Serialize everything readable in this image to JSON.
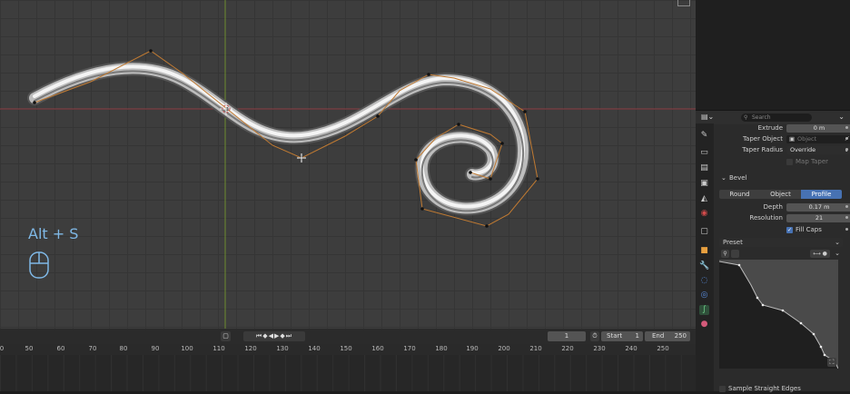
{
  "overlay": {
    "key_hint": "Alt + S"
  },
  "timeline": {
    "current_frame": "1",
    "start_label": "Start",
    "start_value": "1",
    "end_label": "End",
    "end_value": "250",
    "ticks": [
      "50",
      "60",
      "70",
      "80",
      "90",
      "100",
      "110",
      "120",
      "130",
      "140",
      "150",
      "160",
      "170",
      "180",
      "190",
      "200",
      "210",
      "220",
      "230",
      "240",
      "250"
    ],
    "partial_tick": "0"
  },
  "properties": {
    "search_placeholder": "Search",
    "extrude": {
      "label": "Extrude",
      "value": "0 m"
    },
    "taper_object": {
      "label": "Taper Object",
      "placeholder": "Object"
    },
    "taper_radius": {
      "label": "Taper Radius",
      "value": "Override"
    },
    "map_taper": {
      "label": "Map Taper"
    },
    "bevel": {
      "section_label": "Bevel",
      "modes": [
        "Round",
        "Object",
        "Profile"
      ],
      "active_mode": "Profile",
      "depth": {
        "label": "Depth",
        "value": "0.17 m"
      },
      "resolution": {
        "label": "Resolution",
        "value": "21"
      },
      "fill_caps": {
        "label": "Fill Caps",
        "checked": true
      }
    },
    "preset": {
      "label": "Preset"
    },
    "sample_straight_edges": {
      "label": "Sample Straight Edges"
    }
  },
  "colors": {
    "accent": "#4772b3",
    "curve_handle": "#d08a3c",
    "hint_text": "#7fb8e6"
  }
}
